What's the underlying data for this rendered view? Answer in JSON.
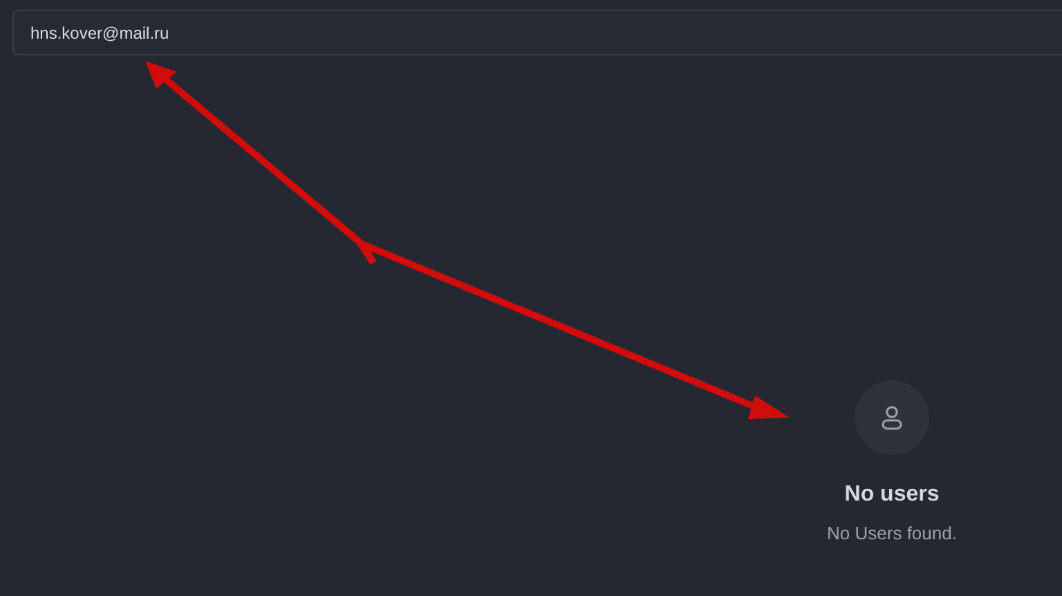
{
  "search": {
    "value": "hns.kover@mail.ru"
  },
  "empty_state": {
    "title": "No users",
    "message": "No Users found."
  }
}
